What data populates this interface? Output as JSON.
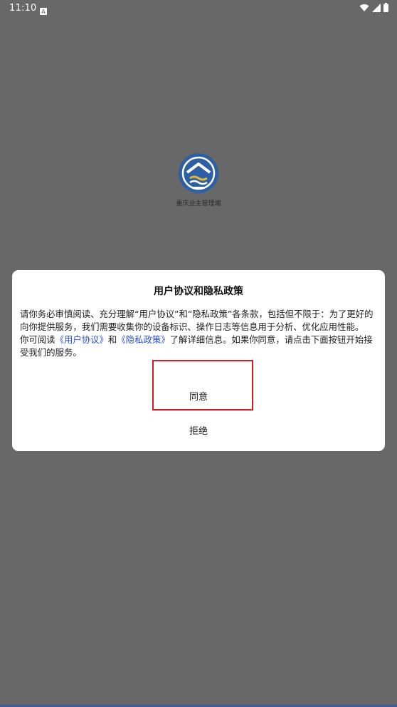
{
  "status_bar": {
    "time": "11:10",
    "icons": [
      "notification-a-icon",
      "wifi-icon",
      "signal-icon",
      "battery-icon"
    ]
  },
  "splash": {
    "app_name": "重庆业主管理端",
    "logo_colors": {
      "outer": "#2d5fa5",
      "inner": "#ffffff",
      "accent": "#e7b52d"
    }
  },
  "dialog": {
    "title": "用户协议和隐私政策",
    "paragraph1": "请你务必审慎阅读、充分理解“用户协议”和“隐私政策”各条款，包括但不限于：为了更好的向你提供服务，我们需要收集你的设备标识、操作日志等信息用于分析、优化应用性能。",
    "paragraph2_prefix": "你可阅读",
    "link_user_agreement": "《用户协议》",
    "paragraph2_mid": "和",
    "link_privacy_policy": "《隐私政策》",
    "paragraph2_suffix": "了解详细信息。如果你同意，请点击下面按钮开始接受我们的服务。",
    "agree_label": "同意",
    "reject_label": "拒绝"
  },
  "colors": {
    "backdrop": "#686868",
    "link": "#2a4fd6",
    "highlight": "#d11d22"
  }
}
